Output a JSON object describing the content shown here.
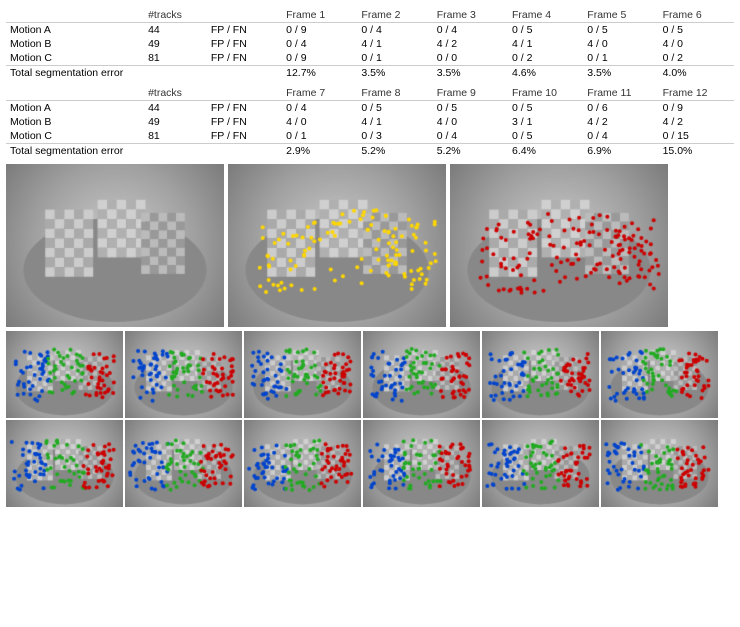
{
  "tables": [
    {
      "id": "table1",
      "headers": [
        "",
        "#tracks",
        "",
        "Frame 1",
        "Frame 2",
        "Frame 3",
        "Frame 4",
        "Frame 5",
        "Frame 6"
      ],
      "rows": [
        {
          "label": "Motion A",
          "tracks": "44",
          "type": "FP / FN",
          "f1": "0 / 9",
          "f2": "0 / 4",
          "f3": "0 / 4",
          "f4": "0 / 5",
          "f5": "0 / 5",
          "f6": "0 / 5"
        },
        {
          "label": "Motion B",
          "tracks": "49",
          "type": "FP / FN",
          "f1": "0 / 4",
          "f2": "4 / 1",
          "f3": "4 / 2",
          "f4": "4 / 1",
          "f5": "4 / 0",
          "f6": "4 / 0"
        },
        {
          "label": "Motion C",
          "tracks": "81",
          "type": "FP / FN",
          "f1": "0 / 9",
          "f2": "0 / 1",
          "f3": "0 / 0",
          "f4": "0 / 2",
          "f5": "0 / 1",
          "f6": "0 / 2"
        }
      ],
      "total": {
        "label": "Total segmentation error",
        "f1": "12.7%",
        "f2": "3.5%",
        "f3": "3.5%",
        "f4": "4.6%",
        "f5": "3.5%",
        "f6": "4.0%"
      }
    },
    {
      "id": "table2",
      "headers": [
        "",
        "#tracks",
        "",
        "Frame 7",
        "Frame 8",
        "Frame 9",
        "Frame 10",
        "Frame 11",
        "Frame 12"
      ],
      "rows": [
        {
          "label": "Motion A",
          "tracks": "44",
          "type": "FP / FN",
          "f1": "0 / 4",
          "f2": "0 / 5",
          "f3": "0 / 5",
          "f4": "0 / 5",
          "f5": "0 / 6",
          "f6": "0 / 9"
        },
        {
          "label": "Motion B",
          "tracks": "49",
          "type": "FP / FN",
          "f1": "4 / 0",
          "f2": "4 / 1",
          "f3": "4 / 0",
          "f4": "3 / 1",
          "f5": "4 / 2",
          "f6": "4 / 2"
        },
        {
          "label": "Motion C",
          "tracks": "81",
          "type": "FP / FN",
          "f1": "0 / 1",
          "f2": "0 / 3",
          "f3": "0 / 4",
          "f4": "0 / 5",
          "f5": "0 / 4",
          "f6": "0 / 15"
        }
      ],
      "total": {
        "label": "Total segmentation error",
        "f1": "2.9%",
        "f2": "5.2%",
        "f3": "5.2%",
        "f4": "6.4%",
        "f5": "6.9%",
        "f6": "15.0%"
      }
    }
  ]
}
